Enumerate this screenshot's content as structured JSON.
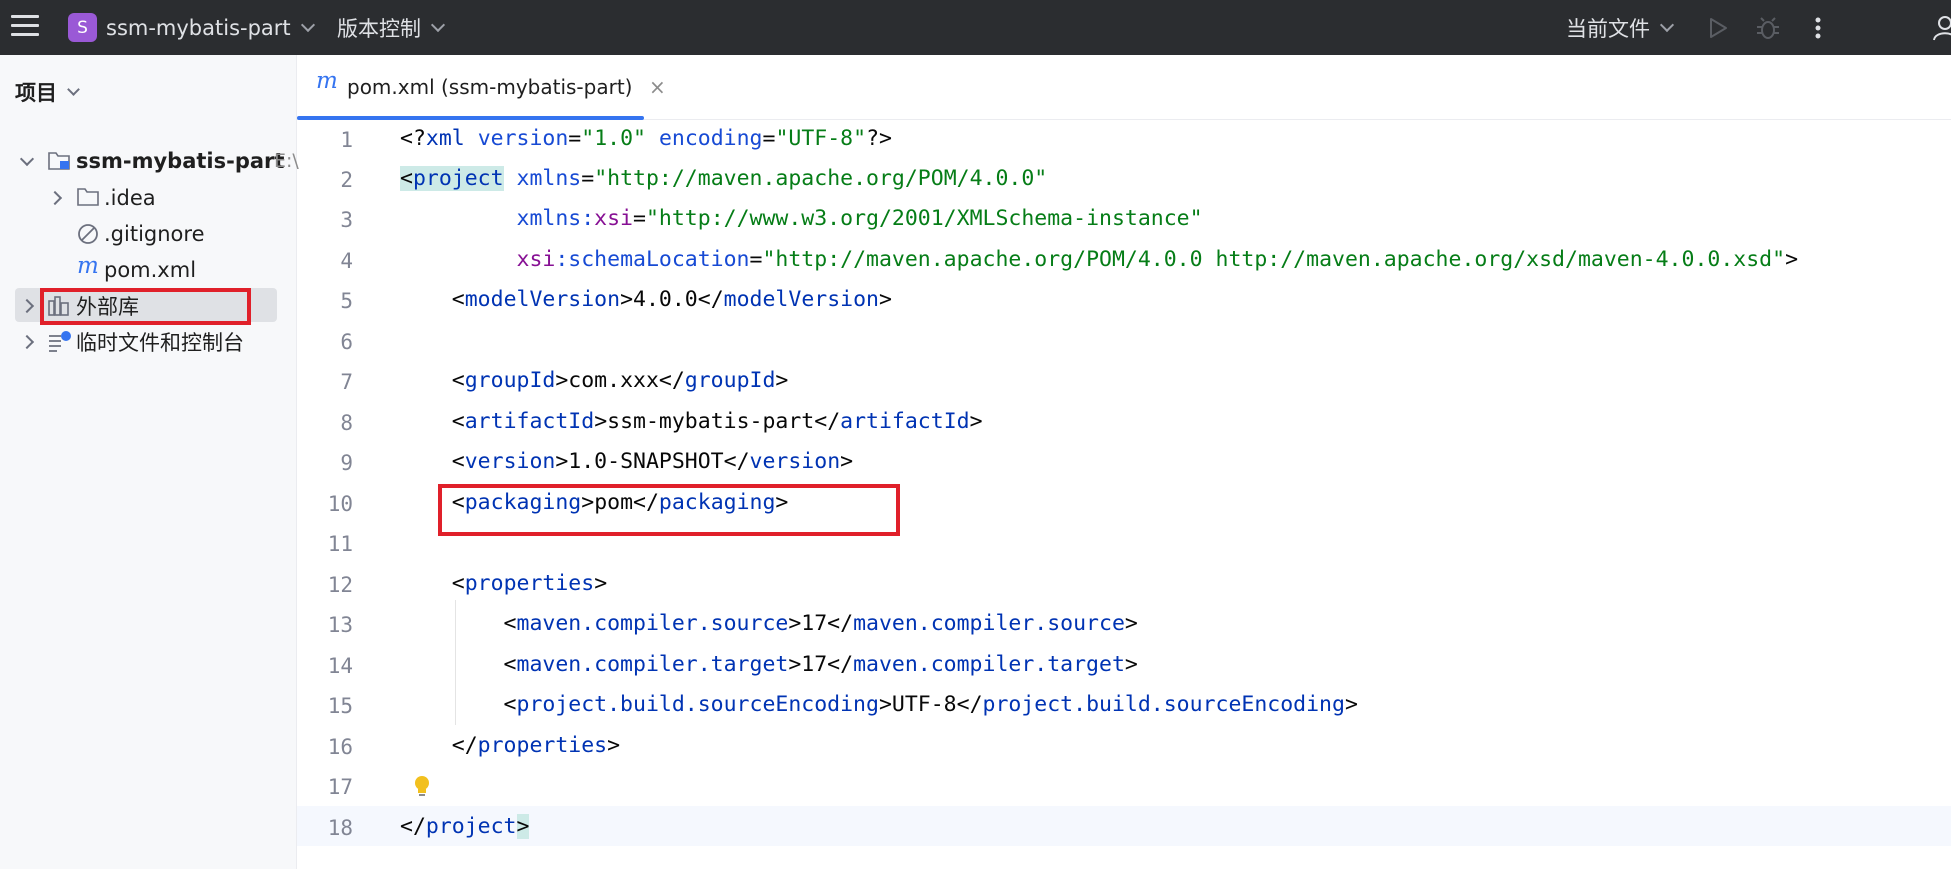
{
  "titlebar": {
    "project_badge": "S",
    "project_name": "ssm-mybatis-part",
    "vcs_label": "版本控制",
    "run_config": "当前文件"
  },
  "project_panel": {
    "title": "项目",
    "tree": [
      {
        "label": "ssm-mybatis-part",
        "suffix": "E:\\",
        "icon": "module-folder-icon"
      },
      {
        "label": ".idea",
        "icon": "folder-icon"
      },
      {
        "label": ".gitignore",
        "icon": "ignore-file-icon"
      },
      {
        "label": "pom.xml",
        "icon": "maven-icon"
      },
      {
        "label": "外部库",
        "icon": "library-icon"
      },
      {
        "label": "临时文件和控制台",
        "icon": "scratches-icon"
      }
    ]
  },
  "editor": {
    "tab_label": "pom.xml (ssm-mybatis-part)",
    "tab_icon_glyph": "m",
    "close_glyph": "×",
    "line_numbers": [
      "1",
      "2",
      "3",
      "4",
      "5",
      "6",
      "7",
      "8",
      "9",
      "10",
      "11",
      "12",
      "13",
      "14",
      "15",
      "16",
      "17",
      "18"
    ],
    "code": {
      "l1_open": "<?",
      "l1_xml": "xml",
      "l1_version_attr": "version",
      "l1_version_val": "\"1.0\"",
      "l1_encoding_attr": "encoding",
      "l1_encoding_val": "\"UTF-8\"",
      "l1_close": "?>",
      "project_tag": "project",
      "xmlns_attr": "xmlns",
      "xmlns_val": "\"http://maven.apache.org/POM/4.0.0\"",
      "xmlns_xsi_prefix": "xmlns:",
      "xmlns_xsi_ns": "xsi",
      "xmlns_xsi_val": "\"http://www.w3.org/2001/XMLSchema-instance\"",
      "schema_ns": "xsi",
      "schema_attr": ":schemaLocation",
      "schema_val": "\"http://maven.apache.org/POM/4.0.0 http://maven.apache.org/xsd/maven-4.0.0.xsd\"",
      "model_version_tag": "modelVersion",
      "model_version": "4.0.0",
      "group_id_tag": "groupId",
      "group_id": "com.xxx",
      "artifact_id_tag": "artifactId",
      "artifact_id": "ssm-mybatis-part",
      "version_tag": "version",
      "version": "1.0-SNAPSHOT",
      "packaging_tag": "packaging",
      "packaging": "pom",
      "properties_tag": "properties",
      "source_tag": "maven.compiler.source",
      "source_val": "17",
      "target_tag": "maven.compiler.target",
      "target_val": "17",
      "encoding_tag": "project.build.sourceEncoding",
      "encoding_val": "UTF-8"
    }
  }
}
